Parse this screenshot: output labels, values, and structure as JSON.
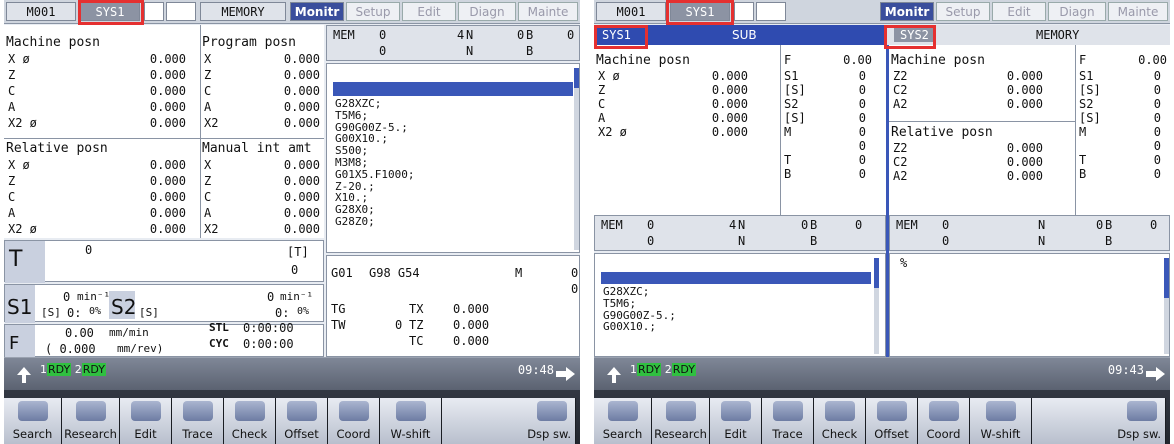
{
  "left": {
    "tabs": {
      "id": "M001",
      "sys": "SYS1",
      "memory": "MEMORY",
      "monitor": "Monitr",
      "setup": "Setup",
      "edit": "Edit",
      "diagn": "Diagn",
      "mainte": "Mainte"
    },
    "machine": {
      "title": "Machine posn",
      "axes": [
        {
          "a": "X",
          "v": "0.000",
          "mark": "ø"
        },
        {
          "a": "Z",
          "v": "0.000"
        },
        {
          "a": "C",
          "v": "0.000"
        },
        {
          "a": "A",
          "v": "0.000"
        },
        {
          "a": "X2",
          "v": "0.000",
          "mark": "ø"
        }
      ]
    },
    "program": {
      "title": "Program posn",
      "axes": [
        {
          "a": "X",
          "v": "0.000"
        },
        {
          "a": "Z",
          "v": "0.000"
        },
        {
          "a": "C",
          "v": "0.000"
        },
        {
          "a": "A",
          "v": "0.000"
        },
        {
          "a": "X2",
          "v": "0.000"
        }
      ]
    },
    "relative": {
      "title": "Relative posn",
      "axes": [
        {
          "a": "X",
          "v": "0.000",
          "mark": "ø"
        },
        {
          "a": "Z",
          "v": "0.000"
        },
        {
          "a": "C",
          "v": "0.000"
        },
        {
          "a": "A",
          "v": "0.000"
        },
        {
          "a": "X2",
          "v": "0.000",
          "mark": "ø"
        }
      ]
    },
    "manual": {
      "title": "Manual int amt",
      "axes": [
        {
          "a": "X",
          "v": "0.000"
        },
        {
          "a": "Z",
          "v": "0.000"
        },
        {
          "a": "C",
          "v": "0.000"
        },
        {
          "a": "A",
          "v": "0.000"
        },
        {
          "a": "X2",
          "v": "0.000"
        }
      ]
    },
    "mem": {
      "label": "MEM",
      "r1a": "0",
      "r1b": "4",
      "r1c": "N",
      "r1d": "0",
      "r1e": "B",
      "r1f": "0",
      "r2a": "0",
      "r2c": "N",
      "r2e": "B"
    },
    "program_lines": [
      "G28XZC;",
      "T5M6;",
      "G90G00Z-5.;",
      "G00X10.;",
      "S500;",
      "M3M8;",
      "G01X5.F1000;",
      "Z-20.;",
      "X10.;",
      "G28X0;",
      "G28Z0;"
    ],
    "tool": {
      "label": "T",
      "value": "0",
      "bracket": "[T]",
      "bracket_val": "0"
    },
    "spindle": {
      "s1": "S1",
      "s1_val": "0",
      "s1_unit": "min⁻¹",
      "s1_s": "[S]",
      "s1_pct": "0:",
      "s1_pct2": "0%",
      "s2": "S2",
      "s2_val": "0",
      "s2_unit": "min⁻¹",
      "s2_s": "[S]",
      "s2_pct": "0:",
      "s2_pct2": "0%"
    },
    "feed": {
      "label": "F",
      "value": "0.00",
      "unit": "mm/min",
      "rev": "( 0.000",
      "rev_unit": "mm/rev)"
    },
    "times": {
      "stl": "STL",
      "stl_v": "0:00:00",
      "cyc": "CYC",
      "cyc_v": "0:00:00"
    },
    "modal": {
      "g1": "G01",
      "g2": "G98 G54",
      "m": "M",
      "m_val": "0",
      "m_val2": "0",
      "tg": "TG",
      "tw": "TW",
      "tw_v": "0",
      "tx": "TX",
      "tx_v": "0.000",
      "tz": "TZ",
      "tz_v": "0.000",
      "tc": "TC",
      "tc_v": "0.000"
    },
    "status": {
      "rdy1": "1",
      "rdy1t": "RDY",
      "rdy2": "2",
      "rdy2t": "RDY",
      "clock": "09:48"
    }
  },
  "right": {
    "tabs": {
      "id": "M001",
      "sys": "SYS1",
      "monitor": "Monitr",
      "setup": "Setup",
      "edit": "Edit",
      "diagn": "Diagn",
      "mainte": "Mainte"
    },
    "sys1": {
      "label": "SYS1",
      "sub": "SUB"
    },
    "sys2": {
      "label": "SYS2",
      "mem": "MEMORY"
    },
    "machine1": {
      "title": "Machine posn",
      "axes": [
        {
          "a": "X",
          "v": "0.000",
          "mark": "ø"
        },
        {
          "a": "Z",
          "v": "0.000"
        },
        {
          "a": "C",
          "v": "0.000"
        },
        {
          "a": "A",
          "v": "0.000"
        },
        {
          "a": "X2",
          "v": "0.000",
          "mark": "ø"
        }
      ]
    },
    "fs1": {
      "f": "F",
      "f_val": "0.00",
      "rows": [
        {
          "k": "S1",
          "v": "0"
        },
        {
          "k": "[S]",
          "v": "0"
        },
        {
          "k": "S2",
          "v": "0"
        },
        {
          "k": "[S]",
          "v": "0"
        },
        {
          "k": "M",
          "v": "0"
        },
        {
          "k": "",
          "v": "0"
        },
        {
          "k": "T",
          "v": "0"
        },
        {
          "k": "B",
          "v": "0"
        }
      ]
    },
    "machine2": {
      "title": "Machine posn",
      "axes": [
        {
          "a": "Z2",
          "v": "0.000"
        },
        {
          "a": "C2",
          "v": "0.000"
        },
        {
          "a": "A2",
          "v": "0.000"
        }
      ]
    },
    "relative2": {
      "title": "Relative posn",
      "axes": [
        {
          "a": "Z2",
          "v": "0.000"
        },
        {
          "a": "C2",
          "v": "0.000"
        },
        {
          "a": "A2",
          "v": "0.000"
        }
      ]
    },
    "fs2": {
      "f": "F",
      "f_val": "0.00",
      "rows": [
        {
          "k": "S1",
          "v": "0"
        },
        {
          "k": "[S]",
          "v": "0"
        },
        {
          "k": "S2",
          "v": "0"
        },
        {
          "k": "[S]",
          "v": "0"
        },
        {
          "k": "M",
          "v": "0"
        },
        {
          "k": "",
          "v": "0"
        },
        {
          "k": "T",
          "v": "0"
        },
        {
          "k": "B",
          "v": "0"
        }
      ]
    },
    "mem1": {
      "label": "MEM",
      "r1a": "0",
      "r1b": "4",
      "r1c": "N",
      "r1d": "0",
      "r1e": "B",
      "r1f": "0",
      "r2a": "0",
      "r2c": "N",
      "r2e": "B"
    },
    "mem2": {
      "label": "MEM",
      "r1a": "0",
      "r1c": "N",
      "r1d": "0",
      "r1e": "B",
      "r1f": "0",
      "r2a": "0",
      "r2c": "N",
      "r2e": "B"
    },
    "program_lines": [
      "G28XZC;",
      "T5M6;",
      "G90G00Z-5.;",
      "G00X10.;"
    ],
    "percent": "%",
    "status": {
      "rdy1": "1",
      "rdy1t": "RDY",
      "rdy2": "2",
      "rdy2t": "RDY",
      "clock": "09:43"
    }
  },
  "fkeys": [
    "Search",
    "Research",
    "Edit",
    "Trace",
    "Check",
    "Offset",
    "Coord",
    "W-shift",
    "Dsp sw."
  ]
}
